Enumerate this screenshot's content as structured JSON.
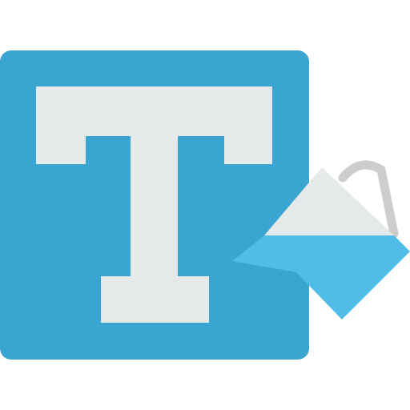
{
  "icon": {
    "name": "text-color-fill-icon",
    "parts": [
      "text-letter-icon",
      "paint-bucket-icon"
    ]
  },
  "colors": {
    "tile": "#3AA5D0",
    "letter": "#E6E9EA",
    "bucket_body": "#E6E9EA",
    "bucket_paint": "#52BCE8",
    "bucket_handle": "#CDCDCD"
  }
}
